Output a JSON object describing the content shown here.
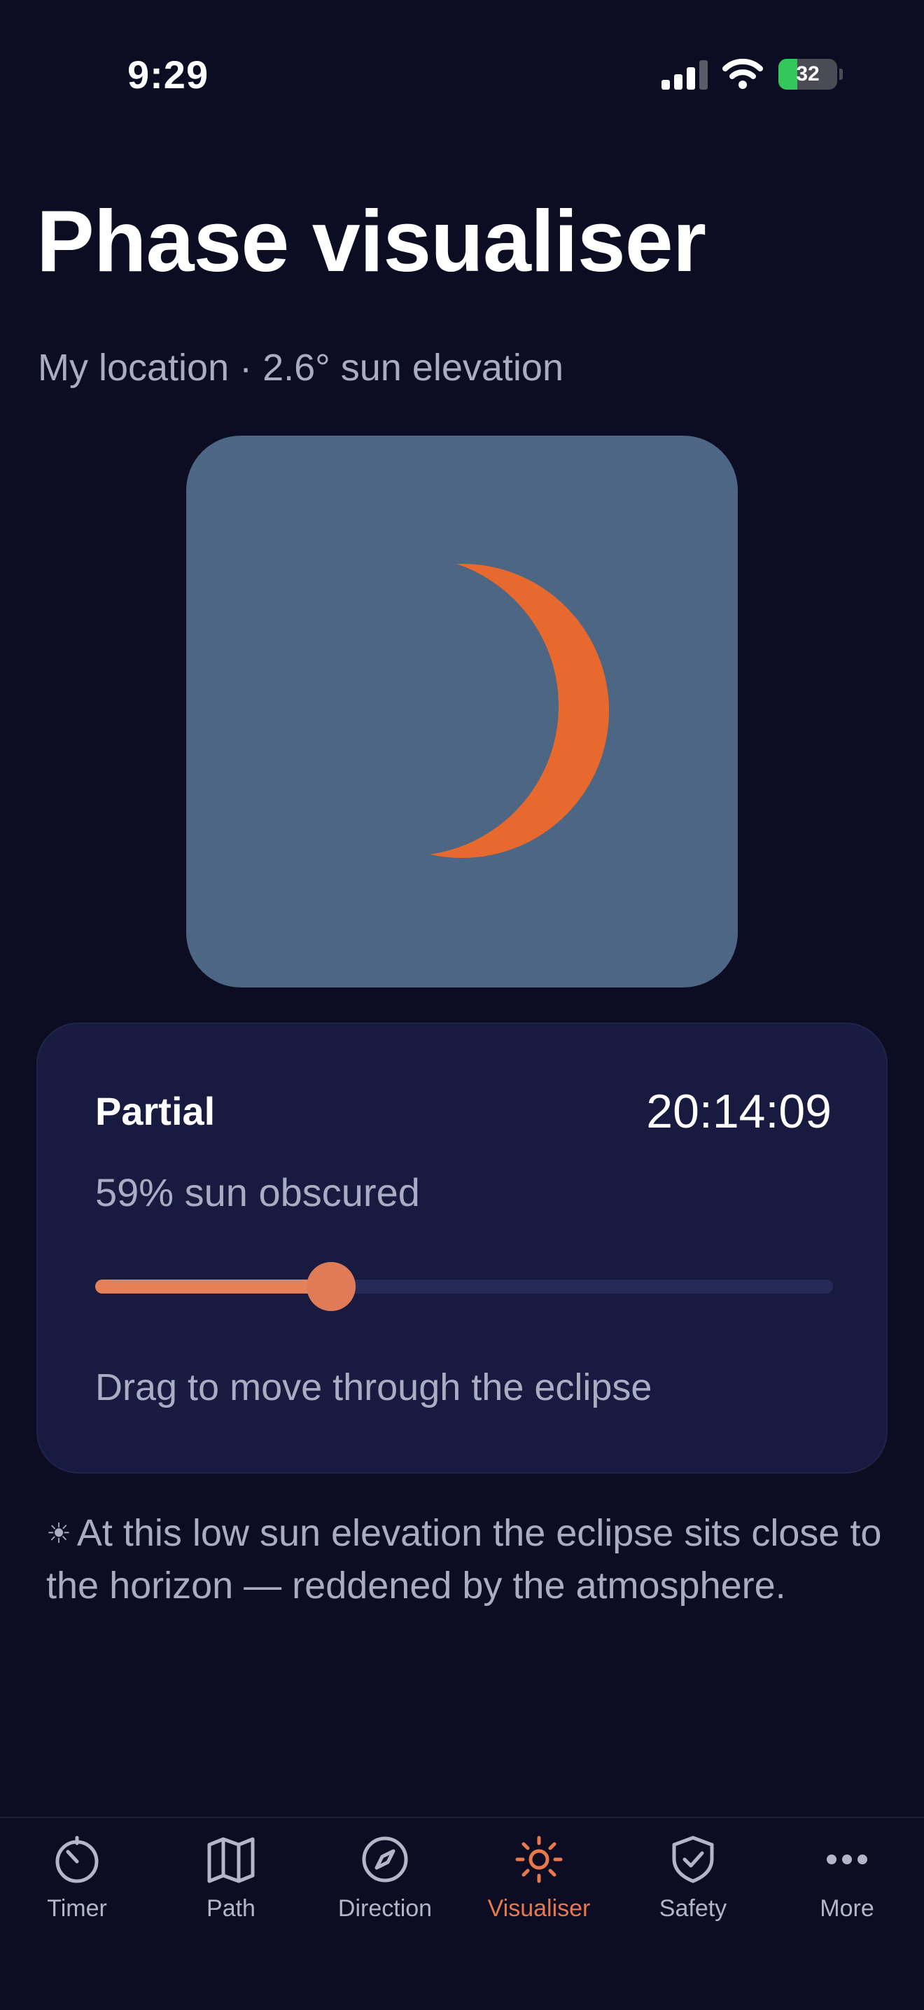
{
  "status_bar": {
    "time": "9:29",
    "battery_percent": 32,
    "battery_label": "32"
  },
  "header": {
    "title": "Phase visualiser",
    "subtitle": "My location · 2.6° sun elevation"
  },
  "phase": {
    "obscured_fraction": 0.59,
    "sun_color": "#e8692e",
    "sky_color": "#4c6684"
  },
  "card": {
    "phase_label": "Partial",
    "time": "20:14:09",
    "obscured_text": "59% sun obscured",
    "slider_fraction": 0.32,
    "hint": "Drag to move through the eclipse"
  },
  "note": {
    "icon": "☀",
    "text": "At this low sun elevation the eclipse sits close to the horizon — reddened by the atmosphere."
  },
  "tabs": [
    {
      "label": "Timer",
      "icon": "stopwatch-icon"
    },
    {
      "label": "Path",
      "icon": "map-icon"
    },
    {
      "label": "Direction",
      "icon": "compass-icon"
    },
    {
      "label": "Visualiser",
      "icon": "sun-icon",
      "active": true
    },
    {
      "label": "Safety",
      "icon": "shield-check-icon"
    },
    {
      "label": "More",
      "icon": "ellipsis-icon"
    }
  ],
  "colors": {
    "accent": "#e8784e",
    "background": "#0c0d22",
    "card": "#181b3f"
  }
}
